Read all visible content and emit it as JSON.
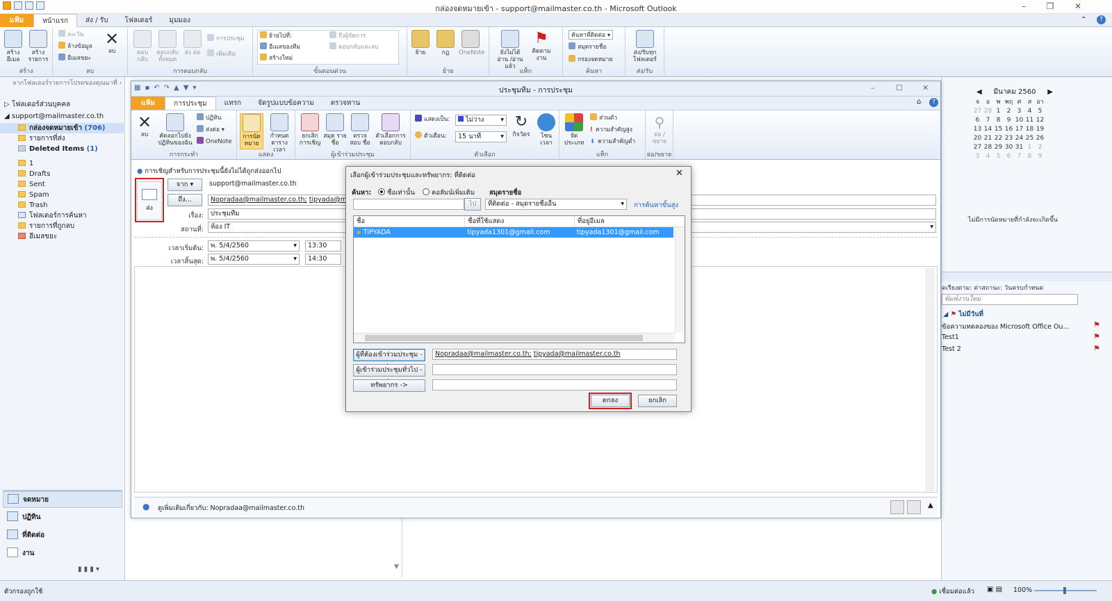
{
  "window": {
    "title": "กล่องจดหมายเข้า - support@mailmaster.co.th - Microsoft Outlook",
    "tabs": [
      "แฟ้ม",
      "หน้าแรก",
      "ส่ง / รับ",
      "โฟลเดอร์",
      "มุมมอง"
    ]
  },
  "ribbon": {
    "groups": [
      "สร้าง",
      "ลบ",
      "การตอบกลับ",
      "ขั้นตอนด่วน",
      "ย้าย",
      "แท็ก",
      "ค้นหา",
      "ส่ง/รับ"
    ],
    "buttons": {
      "new_email": "สร้าง อีเมล",
      "new_items": "สร้าง รายการ",
      "ignore": "ละเว้น",
      "cleanup": "ล้างข้อมูล",
      "junk": "อีเมลขยะ",
      "delete": "ลบ",
      "reply": "ตอบ กลับ",
      "reply_all": "ตอบกลับ ทั้งหมด",
      "forward": "ส่ง ต่อ",
      "meeting": "การประชุม",
      "more": "เพิ่มเติม",
      "move_to": "ย้ายไปที่:",
      "team_email": "อีเมลของทีม",
      "create_new": "สร้างใหม่",
      "to_manager": "ถึงผู้จัดการ",
      "reply_delete": "ตอบกลับและลบ",
      "move": "ย้าย",
      "rules": "กฎ",
      "onenote": "OneNote",
      "unread_read": "ยังไม่ได้อ่าน /อ่านแล้ว",
      "follow_up": "ติดตาม งาน",
      "find_contact": "ค้นหาที่ติดต่อ",
      "address_book": "สมุดรายชื่อ",
      "filter_email": "กรองจดหมาย",
      "send_receive_all": "ส่ง/รับทุก โฟลเดอร์"
    }
  },
  "nav": {
    "drag_hint": "ลากโฟลเดอร์รายการโปรดของคุณมาที่",
    "personal_folders": "โฟลเดอร์ส่วนบุคคล",
    "account": "support@mailmaster.co.th",
    "inbox": "กล่องจดหมายเข้า",
    "inbox_count": "(706)",
    "sent_items": "รายการที่ส่ง",
    "deleted_items": "Deleted Items",
    "deleted_count": "(1)",
    "folders": [
      "1",
      "Drafts",
      "Sent",
      "Spam",
      "Trash",
      "โฟลเดอร์การค้นหา",
      "รายการที่ถูกลบ",
      "อีเมลขยะ"
    ],
    "modules": [
      "จดหมาย",
      "ปฏิทิน",
      "ที่ติดต่อ",
      "งาน"
    ]
  },
  "meeting": {
    "title": "ประชุมทีม  - การประชุม",
    "tabs": [
      "แฟ้ม",
      "การประชุม",
      "แทรก",
      "จัดรูปแบบข้อความ",
      "ตรวจทาน"
    ],
    "groups": [
      "การกระทำ",
      "แสดง",
      "ผู้เข้าร่วมประชุม",
      "ตัวเลือก",
      "แท็ก",
      "ย่อ/ขยาย"
    ],
    "buttons": {
      "delete": "ลบ",
      "copy_calendar": "คัดลอกไปยัง ปฏิทินของฉัน",
      "calendar": "ปฏิทิน",
      "forward": "ส่งต่อ",
      "onenote": "OneNote",
      "appointment": "การนัด หมาย",
      "scheduling": "กำหนด ตารางเวลา",
      "cancel_invite": "ยกเลิก การเชิญ",
      "address_book": "สมุด รายชื่อ",
      "check_names": "ตรวจสอบ ชื่อ",
      "response_options": "ตัวเลือกการ ตอบกลับ",
      "show_as_label": "แสดงเป็น:",
      "show_as_value": "ไม่ว่าง",
      "reminder_label": "ตัวเตือน:",
      "reminder_value": "15 นาที",
      "recurrence": "กิจวัตร",
      "time_zones": "โซน เวลา",
      "categorize": "จัด ประเภท",
      "private": "ส่วนตัว",
      "high_importance": "ความสำคัญสูง",
      "low_importance": "ความสำคัญต่ำ",
      "zoom": "ย่อ /ขยาย"
    },
    "info": "การเชิญสำหรับการประชุมนี้ยังไม่ได้ถูกส่งออกไป",
    "send_label": "ส่ง",
    "from_label": "จาก",
    "from_value": "support@mailmaster.co.th",
    "to_label": "ถึง...",
    "to_value1": "Nopradaa@mailmaster.co.th;",
    "to_value2": "tipyada@mailmaste",
    "subject_label": "เรื่อง:",
    "subject_value": "ประชุมทีม",
    "location_label": "สถานที่:",
    "location_value": "ห้อง IT",
    "start_label": "เวลาเริ่มต้น:",
    "start_date": "พ. 5/4/2560",
    "start_time": "13:30",
    "end_label": "เวลาสิ้นสุด:",
    "end_date": "พ. 5/4/2560",
    "end_time": "14:30",
    "people_info": "ดูเพิ่มเติมเกี่ยวกับ: Nopradaa@mailmaster.co.th"
  },
  "dialog": {
    "title": "เลือกผู้เข้าร่วมประชุมและทรัพยากร: ที่ติดต่อ",
    "search_label": "ค้นหา:",
    "radio_name_only": "ชื่อเท่านั้น",
    "radio_more_columns": "คอลัมน์เพิ่มเติม",
    "address_book_label": "สมุดรายชื่อ",
    "search_value": "",
    "go_button": "ไป",
    "address_book_value": "ที่ติดต่อ - สมุดรายชื่ออื่น",
    "advanced_find": "การค้นหาขั้นสูง",
    "columns": [
      "ชื่อ",
      "ชื่อที่ใช้แสดง",
      "ที่อยู่อีเมล"
    ],
    "rows": [
      {
        "name": "TIPYADA",
        "display": "tipyada1301@gmail.com",
        "email": "tipyada1301@gmail.com"
      }
    ],
    "required_button": "ผู้ที่ต้องเข้าร่วมประชุม ->",
    "required_value1": "Nopradaa@mailmaster.co.th;",
    "required_value2": "tipyada@mailmaster.co.th",
    "optional_button": "ผู้เข้าร่วมประชุมทั่วไป ->",
    "resources_button": "ทรัพยากร ->",
    "ok": "ตกลง",
    "cancel": "ยกเลิก"
  },
  "todo": {
    "month": "มีนาคม 2560",
    "weekdays": [
      "จ",
      "อ",
      "พ",
      "พฤ",
      "ศ",
      "ส",
      "อา"
    ],
    "weeks": [
      [
        "27",
        "28",
        "1",
        "2",
        "3",
        "4",
        "5"
      ],
      [
        "6",
        "7",
        "8",
        "9",
        "10",
        "11",
        "12"
      ],
      [
        "13",
        "14",
        "15",
        "16",
        "17",
        "18",
        "19"
      ],
      [
        "20",
        "21",
        "22",
        "23",
        "24",
        "25",
        "26"
      ],
      [
        "27",
        "28",
        "29",
        "30",
        "31",
        "1",
        "2"
      ],
      [
        "3",
        "4",
        "5",
        "6",
        "7",
        "8",
        "9"
      ]
    ],
    "no_appointments": "ไม่มีการนัดหมายที่กำลังจะเกิดขึ้น",
    "arrange_by": "ดเรียงตาม: ค่าสถานะ: วันครบกำหนด",
    "new_task": "พิมพ์งานใหม่",
    "no_date": "ไม่มีวันที่",
    "tasks": [
      "ข้อความทดลองของ Microsoft Office Ou...",
      "Test1",
      "Test 2"
    ]
  },
  "status": {
    "left": "ตัวกรองถูกใช้",
    "connected": "เชื่อมต่อแล้ว",
    "zoom": "100%"
  },
  "colors": {
    "accent": "#f4a020",
    "selection": "#3399ff",
    "highlight": "#d01f1f"
  }
}
